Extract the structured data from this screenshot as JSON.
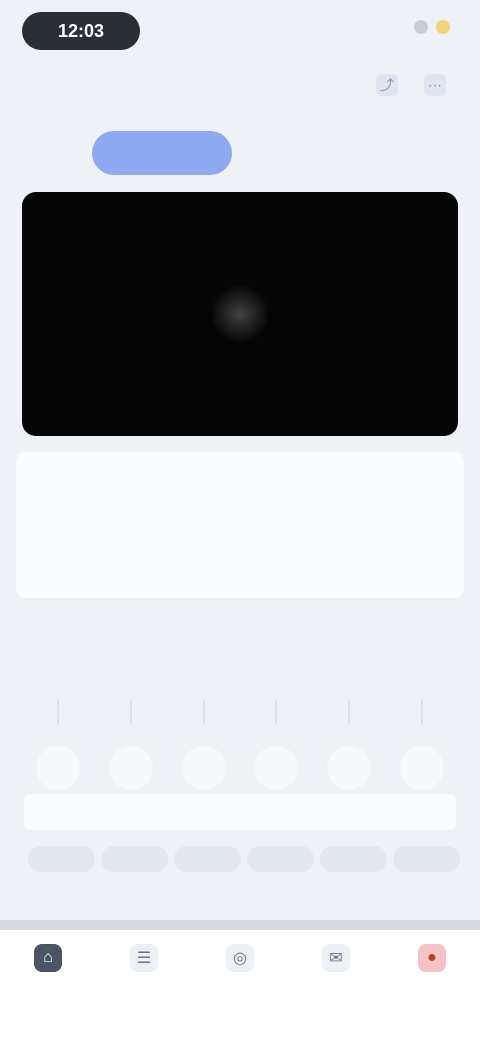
{
  "status_bar": {
    "time": "12:03"
  },
  "header": {
    "title": "",
    "actions": [
      {
        "icon": "share-icon"
      },
      {
        "icon": "more-icon"
      }
    ]
  },
  "tabs": [
    {
      "label": ""
    },
    {
      "label": ""
    },
    {
      "label": ""
    },
    {
      "label": ""
    }
  ],
  "video": {
    "icon": "play-icon"
  },
  "info_card": {
    "label": "",
    "value_1": "",
    "value_2": ""
  },
  "section_title": "",
  "thumbnails": [
    {
      "icon": "circle-icon"
    },
    {
      "icon": "circle-icon"
    },
    {
      "icon": "circle-icon"
    },
    {
      "icon": "circle-icon"
    },
    {
      "icon": "circle-icon"
    },
    {
      "icon": "circle-icon"
    }
  ],
  "description": {
    "label": ""
  },
  "chips": [
    "",
    "",
    "",
    "",
    "",
    ""
  ],
  "bottom_nav": [
    {
      "icon": "home-icon",
      "label": ""
    },
    {
      "icon": "list-icon",
      "label": ""
    },
    {
      "icon": "compass-icon",
      "label": ""
    },
    {
      "icon": "chat-icon",
      "label": ""
    },
    {
      "icon": "profile-icon",
      "label": ""
    }
  ],
  "colors": {
    "accent": "#8ea9ef",
    "video_bg": "#050505",
    "alert": "#c0392b"
  }
}
